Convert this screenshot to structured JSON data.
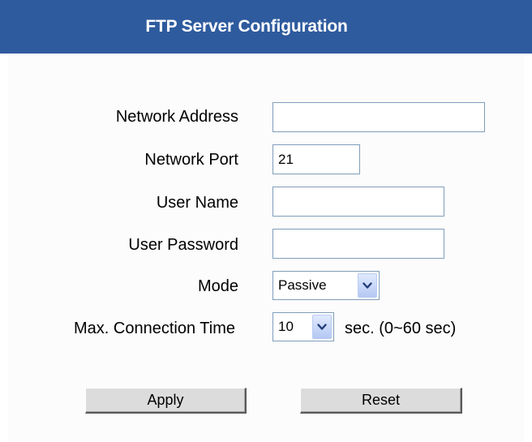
{
  "title": "FTP Server Configuration",
  "colors": {
    "title_bar": "#2e5b9e",
    "title_text": "#ffffff",
    "input_border": "#7f9db9",
    "button_face": "#dcdcdc"
  },
  "form": {
    "network_address": {
      "label": "Network Address",
      "value": ""
    },
    "network_port": {
      "label": "Network Port",
      "value": "21"
    },
    "user_name": {
      "label": "User Name",
      "value": ""
    },
    "user_password": {
      "label": "User Password",
      "value": ""
    },
    "mode": {
      "label": "Mode",
      "selected": "Passive",
      "icon": "chevron-down-icon"
    },
    "max_connection_time": {
      "label": "Max. Connection Time",
      "selected": "10",
      "suffix": "sec. (0~60 sec)",
      "icon": "chevron-down-icon"
    }
  },
  "buttons": {
    "apply": "Apply",
    "reset": "Reset"
  }
}
